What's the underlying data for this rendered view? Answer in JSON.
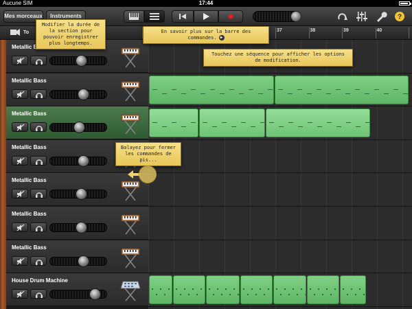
{
  "status": {
    "carrier": "Aucune SIM",
    "time": "17:44"
  },
  "toolbar": {
    "my_songs": "Mes morceaux",
    "instruments": "Instruments",
    "track_label": "To"
  },
  "ruler": {
    "numbers": [
      "37",
      "38",
      "39",
      "40"
    ]
  },
  "tooltips": {
    "section_length": "Modifier la durée de la section pour pouvoir enregistrer plus longtemps.",
    "control_bar": "En savoir plus sur la barre des commandes.",
    "touch_region": "Touchez une séquence pour afficher les options de modification.",
    "swipe": "Balayez pour fermer les commandes de pis..."
  },
  "tracks": [
    {
      "name": "Metallic Bass",
      "volume": 0.55,
      "icon": "keyboard-icon",
      "selected": false
    },
    {
      "name": "Metallic Bass",
      "volume": 0.6,
      "icon": "keyboard-icon",
      "selected": false
    },
    {
      "name": "Metallic Bass",
      "volume": 0.5,
      "icon": "keyboard-icon",
      "selected": true
    },
    {
      "name": "Metallic Bass",
      "volume": 0.6,
      "icon": "keyboard-icon",
      "selected": false
    },
    {
      "name": "Metallic Bass",
      "volume": 0.55,
      "icon": "keyboard-icon",
      "selected": false
    },
    {
      "name": "Metallic Bass",
      "volume": 0.55,
      "icon": "keyboard-icon",
      "selected": false
    },
    {
      "name": "Metallic Bass",
      "volume": 0.6,
      "icon": "keyboard-icon",
      "selected": false
    },
    {
      "name": "House Drum Machine",
      "volume": 0.85,
      "icon": "drum-machine-icon",
      "selected": false
    }
  ],
  "colors": {
    "region_green": "#6fc276",
    "tooltip_yellow": "#f0d270",
    "selected_track": "#3f6a42"
  }
}
